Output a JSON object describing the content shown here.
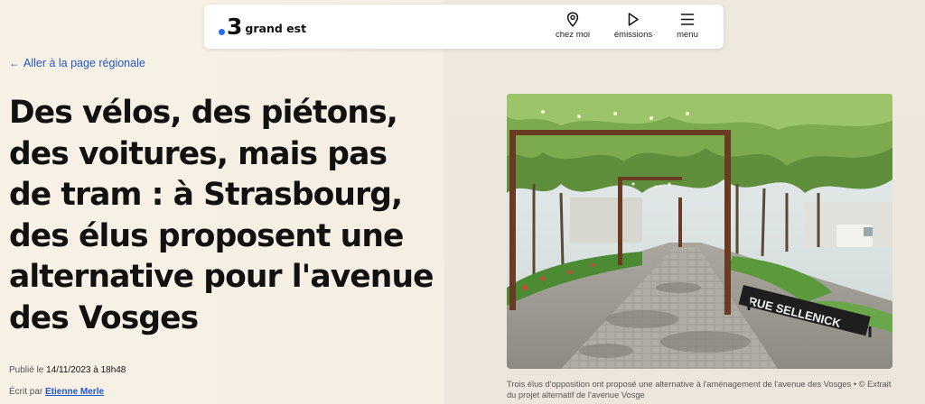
{
  "header": {
    "logo_number": "3",
    "logo_text": "grand est",
    "nav": [
      {
        "label": "chez moi",
        "icon": "location-pin-icon"
      },
      {
        "label": "émissions",
        "icon": "play-icon"
      },
      {
        "label": "menu",
        "icon": "hamburger-icon"
      }
    ]
  },
  "back_link": {
    "arrow": "←",
    "label": "Aller à la page régionale"
  },
  "article": {
    "title": "Des vélos, des piétons, des voitures, mais pas de tram : à Strasbourg, des élus proposent une alternative pour l'avenue des Vosges",
    "published_prefix": "Publié le",
    "published_value": "14/11/2023 à 18h48",
    "author_prefix": "Écrit par",
    "author_name": "Etienne Merle"
  },
  "image": {
    "sign_text": "RUE SELLENICK",
    "caption": "Trois élus d'opposition ont proposé une alternative à l'aménagement de l'avenue des Vosges • © Extrait du projet alternatif de l'avenue Vosge"
  },
  "colors": {
    "link_blue": "#1f57c8",
    "logo_dot": "#2a6ef0",
    "background": "#f8f1e6"
  }
}
